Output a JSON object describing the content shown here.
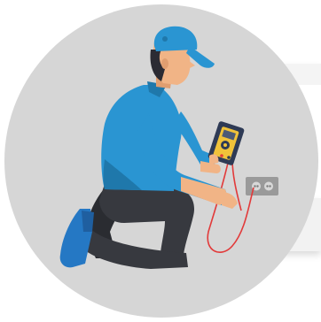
{
  "illustration": {
    "subject": "electrician-with-multimeter",
    "icons": [
      "circle-background",
      "electrician-figure",
      "multimeter-icon",
      "power-outlet-icon",
      "test-lead-wire"
    ]
  },
  "colors": {
    "circle": "#d6d6d6",
    "shirt": "#2a95d2",
    "shirt_shadow": "#1f78ab",
    "pants": "#37393f",
    "pants_shadow": "#2a2c31",
    "shoes": "#2578c4",
    "cap": "#2a95d2",
    "skin": "#f1b486",
    "hair": "#2b2b33",
    "multimeter_body": "#2e3a55",
    "multimeter_face": "#f0c23a",
    "outlet": "#9a9a9a",
    "wire": "#e23a3a"
  }
}
